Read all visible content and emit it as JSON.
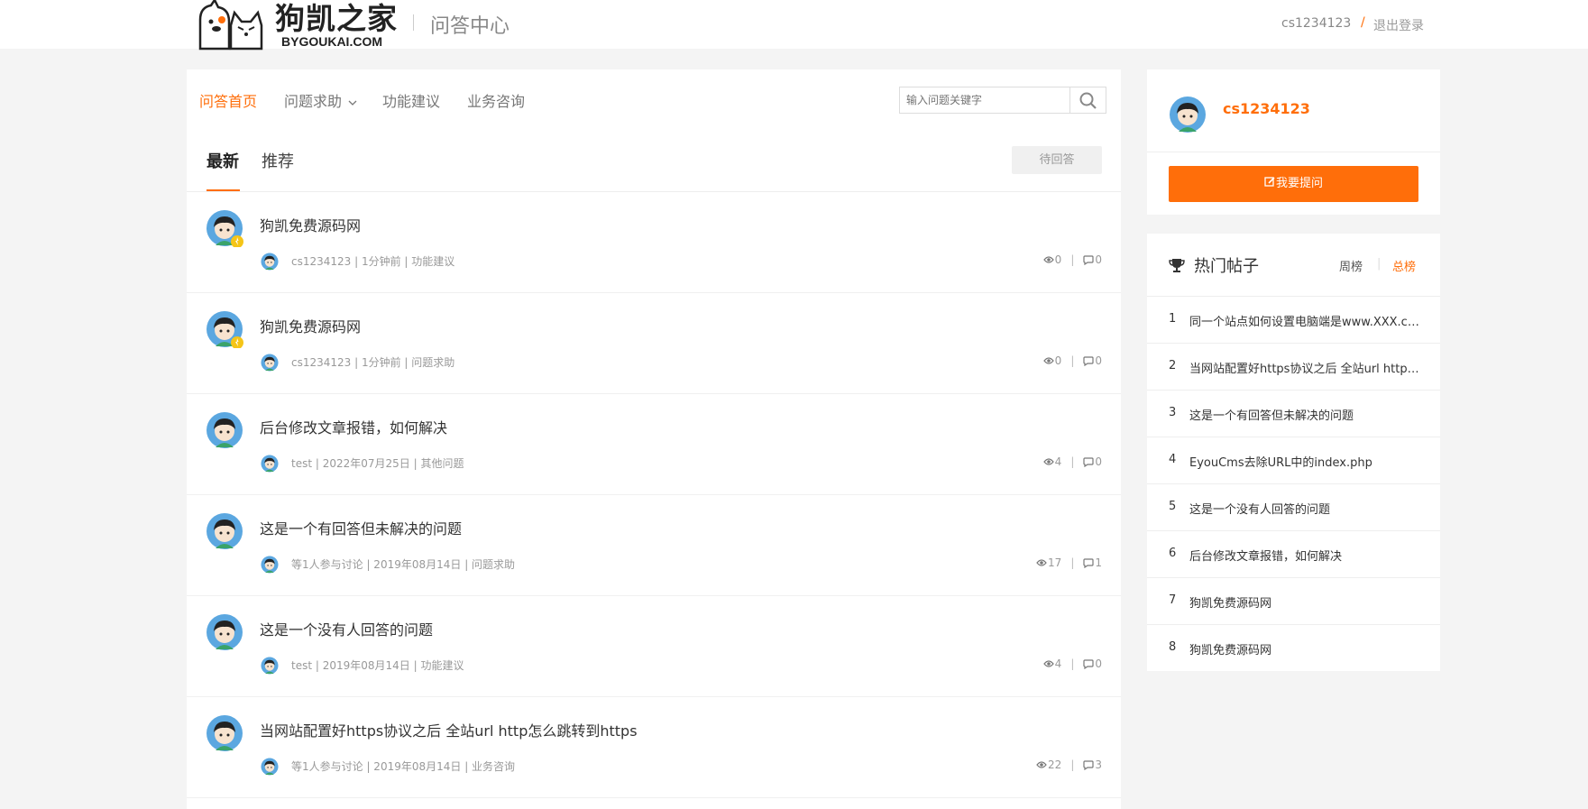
{
  "header": {
    "logo_text": "狗凯之家",
    "logo_sub": "BYGOUKAI.COM",
    "title": "问答中心",
    "username": "cs1234123",
    "slash": "/",
    "logout": "退出登录"
  },
  "nav": {
    "items": [
      "问答首页",
      "问题求助",
      "功能建议",
      "业务咨询"
    ],
    "search_placeholder": "输入问题关键字"
  },
  "tabs": {
    "latest": "最新",
    "recommend": "推荐",
    "pending": "待回答"
  },
  "questions": [
    {
      "title": "狗凯免费源码网",
      "meta": "cs1234123 | 1分钟前 | 功能建议",
      "views": "0",
      "comments": "0",
      "badge": true
    },
    {
      "title": "狗凯免费源码网",
      "meta": "cs1234123 | 1分钟前 | 问题求助",
      "views": "0",
      "comments": "0",
      "badge": true
    },
    {
      "title": "后台修改文章报错，如何解决",
      "meta": "test | 2022年07月25日 | 其他问题",
      "views": "4",
      "comments": "0",
      "badge": false
    },
    {
      "title": "这是一个有回答但未解决的问题",
      "meta": "等1人参与讨论 | 2019年08月14日 | 问题求助",
      "views": "17",
      "comments": "1",
      "badge": false
    },
    {
      "title": "这是一个没有人回答的问题",
      "meta": "test | 2019年08月14日 | 功能建议",
      "views": "4",
      "comments": "0",
      "badge": false
    },
    {
      "title": "当网站配置好https协议之后 全站url http怎么跳转到https",
      "meta": "等1人参与讨论 | 2019年08月14日 | 业务咨询",
      "views": "22",
      "comments": "3",
      "badge": false
    }
  ],
  "sidebar": {
    "username": "cs1234123",
    "ask_button": "我要提问",
    "hot_title": "热门帖子",
    "week": "周榜",
    "bar": "|",
    "total": "总榜",
    "hot_items": [
      {
        "num": "1",
        "text": "同一个站点如何设置电脑端是www.XXX.com"
      },
      {
        "num": "2",
        "text": "当网站配置好https协议之后 全站url http怎么跳转到https"
      },
      {
        "num": "3",
        "text": "这是一个有回答但未解决的问题"
      },
      {
        "num": "4",
        "text": "EyouCms去除URL中的index.php"
      },
      {
        "num": "5",
        "text": "这是一个没有人回答的问题"
      },
      {
        "num": "6",
        "text": "后台修改文章报错，如何解决"
      },
      {
        "num": "7",
        "text": "狗凯免费源码网"
      },
      {
        "num": "8",
        "text": "狗凯免费源码网"
      }
    ]
  },
  "colors": {
    "accent": "#ff6e0a",
    "background": "#f4f4f4"
  },
  "icons": [
    "cat-dog-logo",
    "search-icon",
    "chevron-down-icon",
    "eye-icon",
    "comment-icon",
    "edit-icon",
    "trophy-icon",
    "avatar",
    "badge-icon"
  ]
}
